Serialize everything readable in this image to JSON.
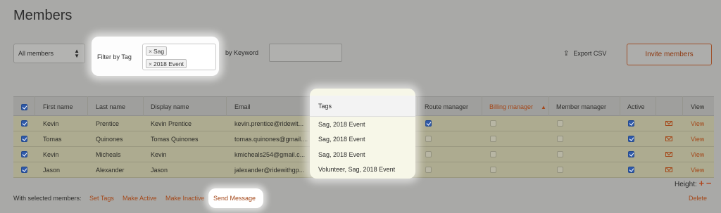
{
  "page": {
    "title": "Members"
  },
  "filters": {
    "members_select": "All members",
    "filter_by_tag_label": "Filter by Tag",
    "selected_tags": [
      "Sag",
      "2018 Event"
    ],
    "keyword_label": "by Keyword",
    "keyword_value": ""
  },
  "toolbar": {
    "export_label": "Export CSV",
    "invite_label": "Invite members"
  },
  "table": {
    "columns": [
      "First name",
      "Last name",
      "Display name",
      "Email",
      "Tags",
      "Route manager",
      "Billing manager",
      "Member manager",
      "Active",
      "View"
    ],
    "sorted_column": "Billing manager",
    "sort_direction": "asc",
    "rows": [
      {
        "first": "Kevin",
        "last": "Prentice",
        "display": "Kevin Prentice",
        "email": "kevin.prentice@ridewit...",
        "tags": "Sag, 2018 Event",
        "route_manager": true,
        "billing_manager": false,
        "member_manager": false,
        "active": true,
        "view": "View"
      },
      {
        "first": "Tomas",
        "last": "Quinones",
        "display": "Tomas Quinones",
        "email": "tomas.quinones@gmail....",
        "tags": "Sag, 2018 Event",
        "route_manager": false,
        "billing_manager": false,
        "member_manager": false,
        "active": true,
        "view": "View"
      },
      {
        "first": "Kevin",
        "last": "Micheals",
        "display": "Kevin",
        "email": "kmicheals254@gmail.c...",
        "tags": "Sag, 2018 Event",
        "route_manager": false,
        "billing_manager": false,
        "member_manager": false,
        "active": true,
        "view": "View"
      },
      {
        "first": "Jason",
        "last": "Alexander",
        "display": "Jason",
        "email": "jalexander@ridewithgp...",
        "tags": "Volunteer, Sag, 2018 Event",
        "route_manager": false,
        "billing_manager": false,
        "member_manager": false,
        "active": true,
        "view": "View"
      }
    ]
  },
  "height_control": {
    "label": "Height:",
    "plus": "+",
    "minus": "−"
  },
  "bulk_actions": {
    "label": "With selected members:",
    "set_tags": "Set Tags",
    "make_active": "Make Active",
    "make_inactive": "Make Inactive",
    "send_message": "Send Message",
    "delete": "Delete"
  },
  "colors": {
    "accent": "#a4481a",
    "checkbox": "#2f59a8",
    "selected_row": "#adab90"
  }
}
